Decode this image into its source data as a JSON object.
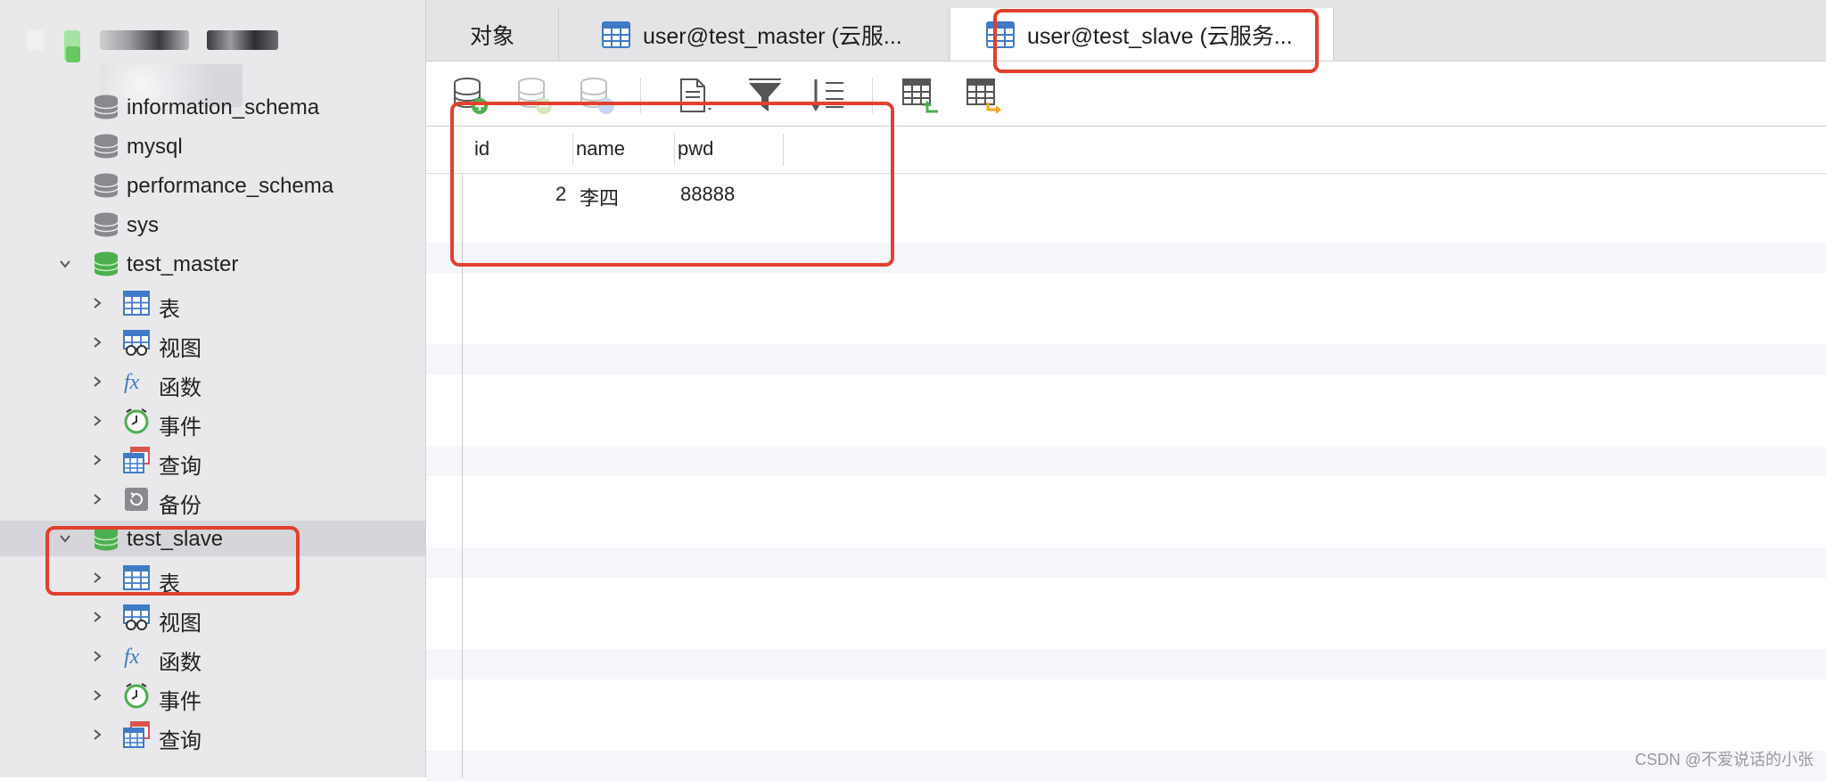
{
  "sidebar": {
    "items": [
      {
        "label": "information_schema",
        "kind": "db-gray"
      },
      {
        "label": "mysql",
        "kind": "db-gray"
      },
      {
        "label": "performance_schema",
        "kind": "db-gray"
      },
      {
        "label": "sys",
        "kind": "db-gray"
      },
      {
        "label": "test_master",
        "kind": "db-green",
        "expanded": true
      },
      {
        "label": "表",
        "kind": "table"
      },
      {
        "label": "视图",
        "kind": "view"
      },
      {
        "label": "函数",
        "kind": "function"
      },
      {
        "label": "事件",
        "kind": "event"
      },
      {
        "label": "查询",
        "kind": "query"
      },
      {
        "label": "备份",
        "kind": "backup"
      },
      {
        "label": "test_slave",
        "kind": "db-green",
        "expanded": true,
        "selected": true
      },
      {
        "label": "表",
        "kind": "table"
      },
      {
        "label": "视图",
        "kind": "view"
      },
      {
        "label": "函数",
        "kind": "function"
      },
      {
        "label": "事件",
        "kind": "event"
      },
      {
        "label": "查询",
        "kind": "query"
      }
    ]
  },
  "tabs": [
    {
      "label": "对象",
      "active": false
    },
    {
      "label": "user@test_master (云服...",
      "active": false
    },
    {
      "label": "user@test_slave (云服务...",
      "active": true
    }
  ],
  "toolbar": {
    "buttons": [
      "add-record-icon",
      "delete-record-icon",
      "refresh-record-icon",
      "text-view-icon",
      "filter-icon",
      "sort-icon",
      "import-icon",
      "export-icon"
    ]
  },
  "grid": {
    "columns": [
      "id",
      "name",
      "pwd"
    ],
    "rows": [
      {
        "id": "2",
        "name": "李四",
        "pwd": "88888"
      }
    ]
  },
  "colors": {
    "annotation": "#e2402e",
    "db_green": "#4caf50",
    "db_gray": "#8a8a8e"
  },
  "watermark": "CSDN @不爱说话的小张"
}
